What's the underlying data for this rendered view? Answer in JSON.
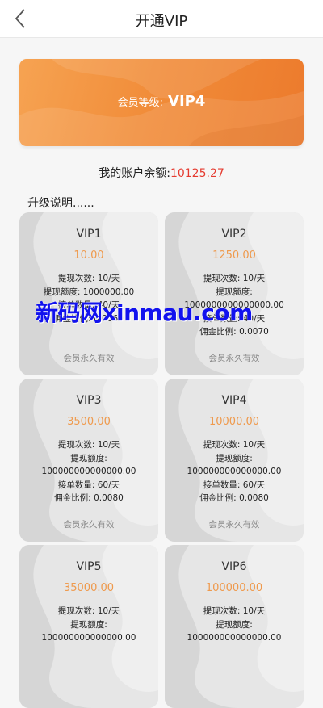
{
  "header": {
    "title": "开通VIP",
    "back_icon": "chevron-left-icon"
  },
  "banner": {
    "label": "会员等级:",
    "level": "VIP4",
    "colors": {
      "start": "#f6a352",
      "end": "#ec7a2c"
    }
  },
  "balance": {
    "label": "我的账户余额:",
    "value": "10125.27",
    "value_color": "#e53a2f"
  },
  "section_title": "升级说明......",
  "price_color": "#ef9a4d",
  "cards": [
    {
      "name": "VIP1",
      "price": "10.00",
      "details": [
        "提现次数: 10/天",
        "提现额度: 1000000.00",
        "接单数量: 40/天",
        "佣金比例: 0.0060"
      ],
      "validity": "会员永久有效"
    },
    {
      "name": "VIP2",
      "price": "1250.00",
      "details": [
        "提现次数: 10/天",
        "提现额度:",
        "1000000000000000.00",
        "接单数量: 40/天",
        "佣金比例: 0.0070"
      ],
      "validity": "会员永久有效"
    },
    {
      "name": "VIP3",
      "price": "3500.00",
      "details": [
        "提现次数: 10/天",
        "提现额度:",
        "100000000000000.00",
        "接单数量: 60/天",
        "佣金比例: 0.0080"
      ],
      "validity": "会员永久有效"
    },
    {
      "name": "VIP4",
      "price": "10000.00",
      "details": [
        "提现次数: 10/天",
        "提现额度:",
        "100000000000000.00",
        "接单数量: 60/天",
        "佣金比例: 0.0080"
      ],
      "validity": "会员永久有效"
    },
    {
      "name": "VIP5",
      "price": "35000.00",
      "details": [
        "提现次数: 10/天",
        "提现额度:",
        "100000000000000.00"
      ],
      "validity": ""
    },
    {
      "name": "VIP6",
      "price": "100000.00",
      "details": [
        "提现次数: 10/天",
        "提现额度:",
        "100000000000000.00"
      ],
      "validity": ""
    }
  ],
  "watermark": "新码网xinmau.com"
}
